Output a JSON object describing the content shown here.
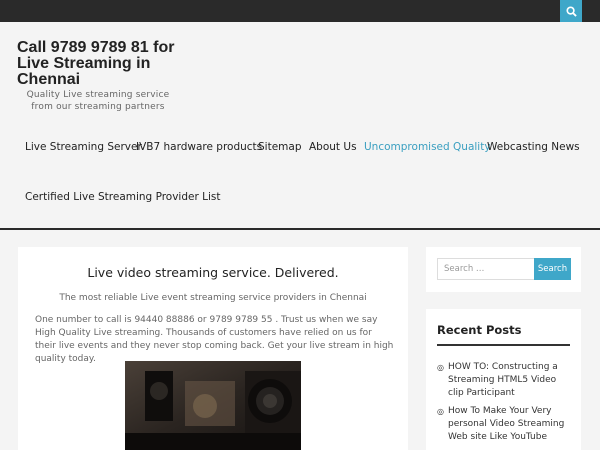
{
  "header": {
    "site_title": "Call 9789 9789 81 for Live Streaming in Chennai",
    "site_description": "Quality Live streaming service from our streaming partners",
    "search_icon": "search-icon"
  },
  "nav": {
    "items": [
      {
        "label": "Live Streaming Server"
      },
      {
        "label": "IVB7 hardware products"
      },
      {
        "label": "Sitemap"
      },
      {
        "label": "About Us"
      },
      {
        "label": "Uncompromised Quality"
      },
      {
        "label": "Webcasting News"
      },
      {
        "label": "Certified Live Streaming Provider List"
      }
    ],
    "active_color": "#3a9fc0"
  },
  "post": {
    "title": "Live video streaming service. Delivered.",
    "tagline": "The most reliable Live event streaming service providers in Chennai",
    "body": "One number to call is 94440 88886 or 9789 9789 55 . Trust us when we say High Quality Live streaming. Thousands of customers have relied on us for their live events and they never stop coming back. Get your live stream in high quality today."
  },
  "sidebar": {
    "search": {
      "placeholder": "Search …",
      "button_label": "Search"
    },
    "recent_posts": {
      "title": "Recent Posts",
      "items": [
        {
          "label": "HOW TO: Constructing a Streaming HTML5 Video clip Participant"
        },
        {
          "label": "How To Make Your Very personal Video Streaming Web site Like YouTube"
        }
      ]
    }
  },
  "colors": {
    "accent": "#3fa7c9",
    "topbar": "#2a2a2a"
  }
}
